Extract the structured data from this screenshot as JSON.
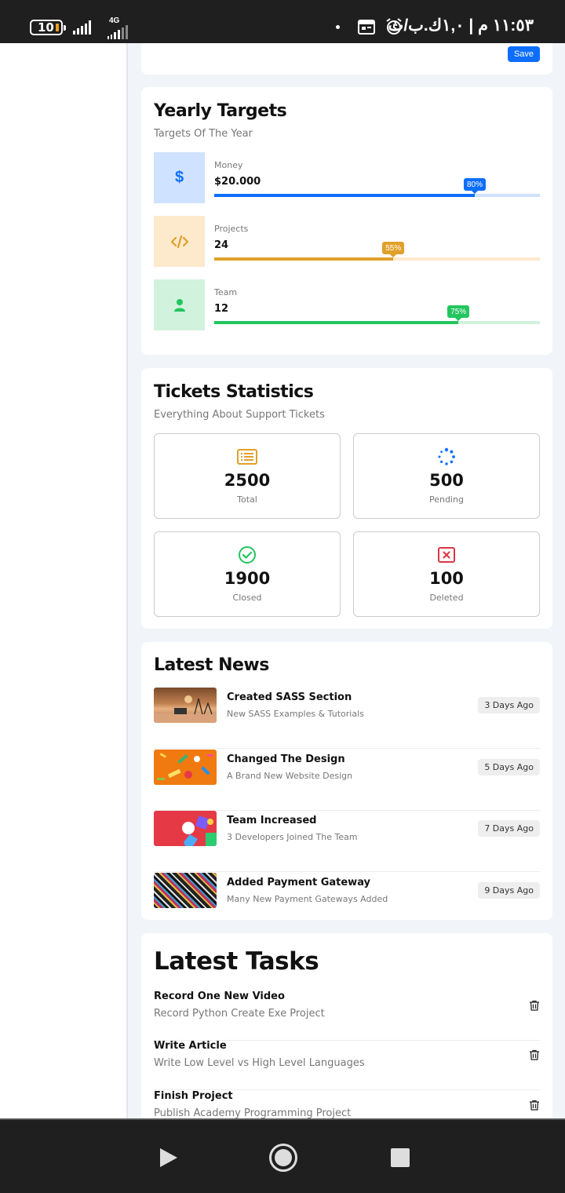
{
  "status_bar": {
    "battery_level": "10",
    "network_type": "4G",
    "time": "١١:٥٣ م | ١,٠ك.ب/ث"
  },
  "settings_card": {
    "save_label": "Save"
  },
  "yearly_targets": {
    "title": "Yearly Targets",
    "subtitle": "Targets Of The Year",
    "items": [
      {
        "label": "Money",
        "value": "$20.000",
        "percent_label": "80%",
        "percent": 80,
        "icon": "dollar-icon",
        "color": "#0d6efd",
        "bg": "#cfe2ff",
        "track": "#cfe2ff"
      },
      {
        "label": "Projects",
        "value": "24",
        "percent_label": "55%",
        "percent": 55,
        "icon": "code-icon",
        "color": "#e0a02a",
        "bg": "#fde9cc",
        "track": "#fde9cc"
      },
      {
        "label": "Team",
        "value": "12",
        "percent_label": "75%",
        "percent": 75,
        "icon": "user-icon",
        "color": "#22c55e",
        "bg": "#d1f2dd",
        "track": "#d1f2dd"
      }
    ]
  },
  "tickets": {
    "title": "Tickets Statistics",
    "subtitle": "Everything About Support Tickets",
    "items": [
      {
        "number": "2500",
        "label": "Total",
        "icon": "list-icon",
        "color": "#e0a02a"
      },
      {
        "number": "500",
        "label": "Pending",
        "icon": "spinner-icon",
        "color": "#0d6efd"
      },
      {
        "number": "1900",
        "label": "Closed",
        "icon": "check-circle-icon",
        "color": "#22c55e"
      },
      {
        "number": "100",
        "label": "Deleted",
        "icon": "x-square-icon",
        "color": "#dc3545"
      }
    ]
  },
  "latest_news": {
    "title": "Latest News",
    "items": [
      {
        "title": "Created SASS Section",
        "description": "New SASS Examples & Tutorials",
        "date": "3 Days Ago"
      },
      {
        "title": "Changed The Design",
        "description": "A Brand New Website Design",
        "date": "5 Days Ago"
      },
      {
        "title": "Team Increased",
        "description": "3 Developers Joined The Team",
        "date": "7 Days Ago"
      },
      {
        "title": "Added Payment Gateway",
        "description": "Many New Payment Gateways Added",
        "date": "9 Days Ago"
      }
    ]
  },
  "latest_tasks": {
    "title": "Latest Tasks",
    "items": [
      {
        "title": "Record One New Video",
        "description": "Record Python Create Exe Project"
      },
      {
        "title": "Write Article",
        "description": "Write Low Level vs High Level Languages"
      },
      {
        "title": "Finish Project",
        "description": "Publish Academy Programming Project"
      }
    ]
  }
}
